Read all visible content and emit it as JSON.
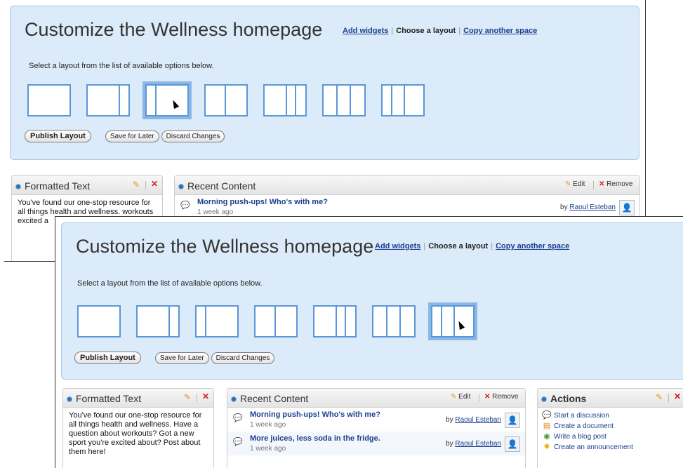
{
  "shots": [
    {
      "header": {
        "title": "Customize the Wellness homepage",
        "links": {
          "add_widgets": "Add widgets",
          "choose_layout": "Choose a layout",
          "copy_space": "Copy another space"
        },
        "instructions": "Select a layout from the list of available options below."
      },
      "layouts": {
        "count": 7,
        "selected_index": 2
      },
      "buttons": {
        "publish": "Publish Layout",
        "save": "Save for Later",
        "discard": "Discard Changes"
      },
      "formatted_text": {
        "title": "Formatted Text",
        "body": "You've found our one-stop resource for all things health and wellness. workouts excited a"
      },
      "recent_content": {
        "title": "Recent Content",
        "edit_label": "Edit",
        "remove_label": "Remove",
        "items": [
          {
            "title": "Morning push-ups! Who's with me?",
            "time": "1 week ago",
            "by_label": "by",
            "author": "Raoul Esteban"
          }
        ]
      }
    },
    {
      "header": {
        "title": "Customize the Wellness homepage",
        "links": {
          "add_widgets": "Add widgets",
          "choose_layout": "Choose a layout",
          "copy_space": "Copy another space"
        },
        "instructions": "Select a layout from the list of available options below."
      },
      "layouts": {
        "count": 7,
        "selected_index": 6
      },
      "buttons": {
        "publish": "Publish Layout",
        "save": "Save for Later",
        "discard": "Discard Changes"
      },
      "formatted_text": {
        "title": "Formatted Text",
        "body": "You've found our one-stop resource for all things health and wellness. Have a question about workouts? Got a new sport you're excited about? Post about them here!"
      },
      "recent_content": {
        "title": "Recent Content",
        "edit_label": "Edit",
        "remove_label": "Remove",
        "items": [
          {
            "title": "Morning push-ups! Who's with me?",
            "time": "1 week ago",
            "by_label": "by",
            "author": "Raoul Esteban"
          },
          {
            "title": "More juices, less soda in the fridge.",
            "time": "1 week ago",
            "by_label": "by",
            "author": "Raoul Esteban"
          }
        ]
      },
      "actions": {
        "title": "Actions",
        "items": [
          {
            "label": "Start a discussion",
            "icon": "discussion-icon"
          },
          {
            "label": "Create a document",
            "icon": "document-icon"
          },
          {
            "label": "Write a blog post",
            "icon": "blog-icon"
          },
          {
            "label": "Create an announcement",
            "icon": "announcement-icon"
          }
        ]
      }
    }
  ]
}
